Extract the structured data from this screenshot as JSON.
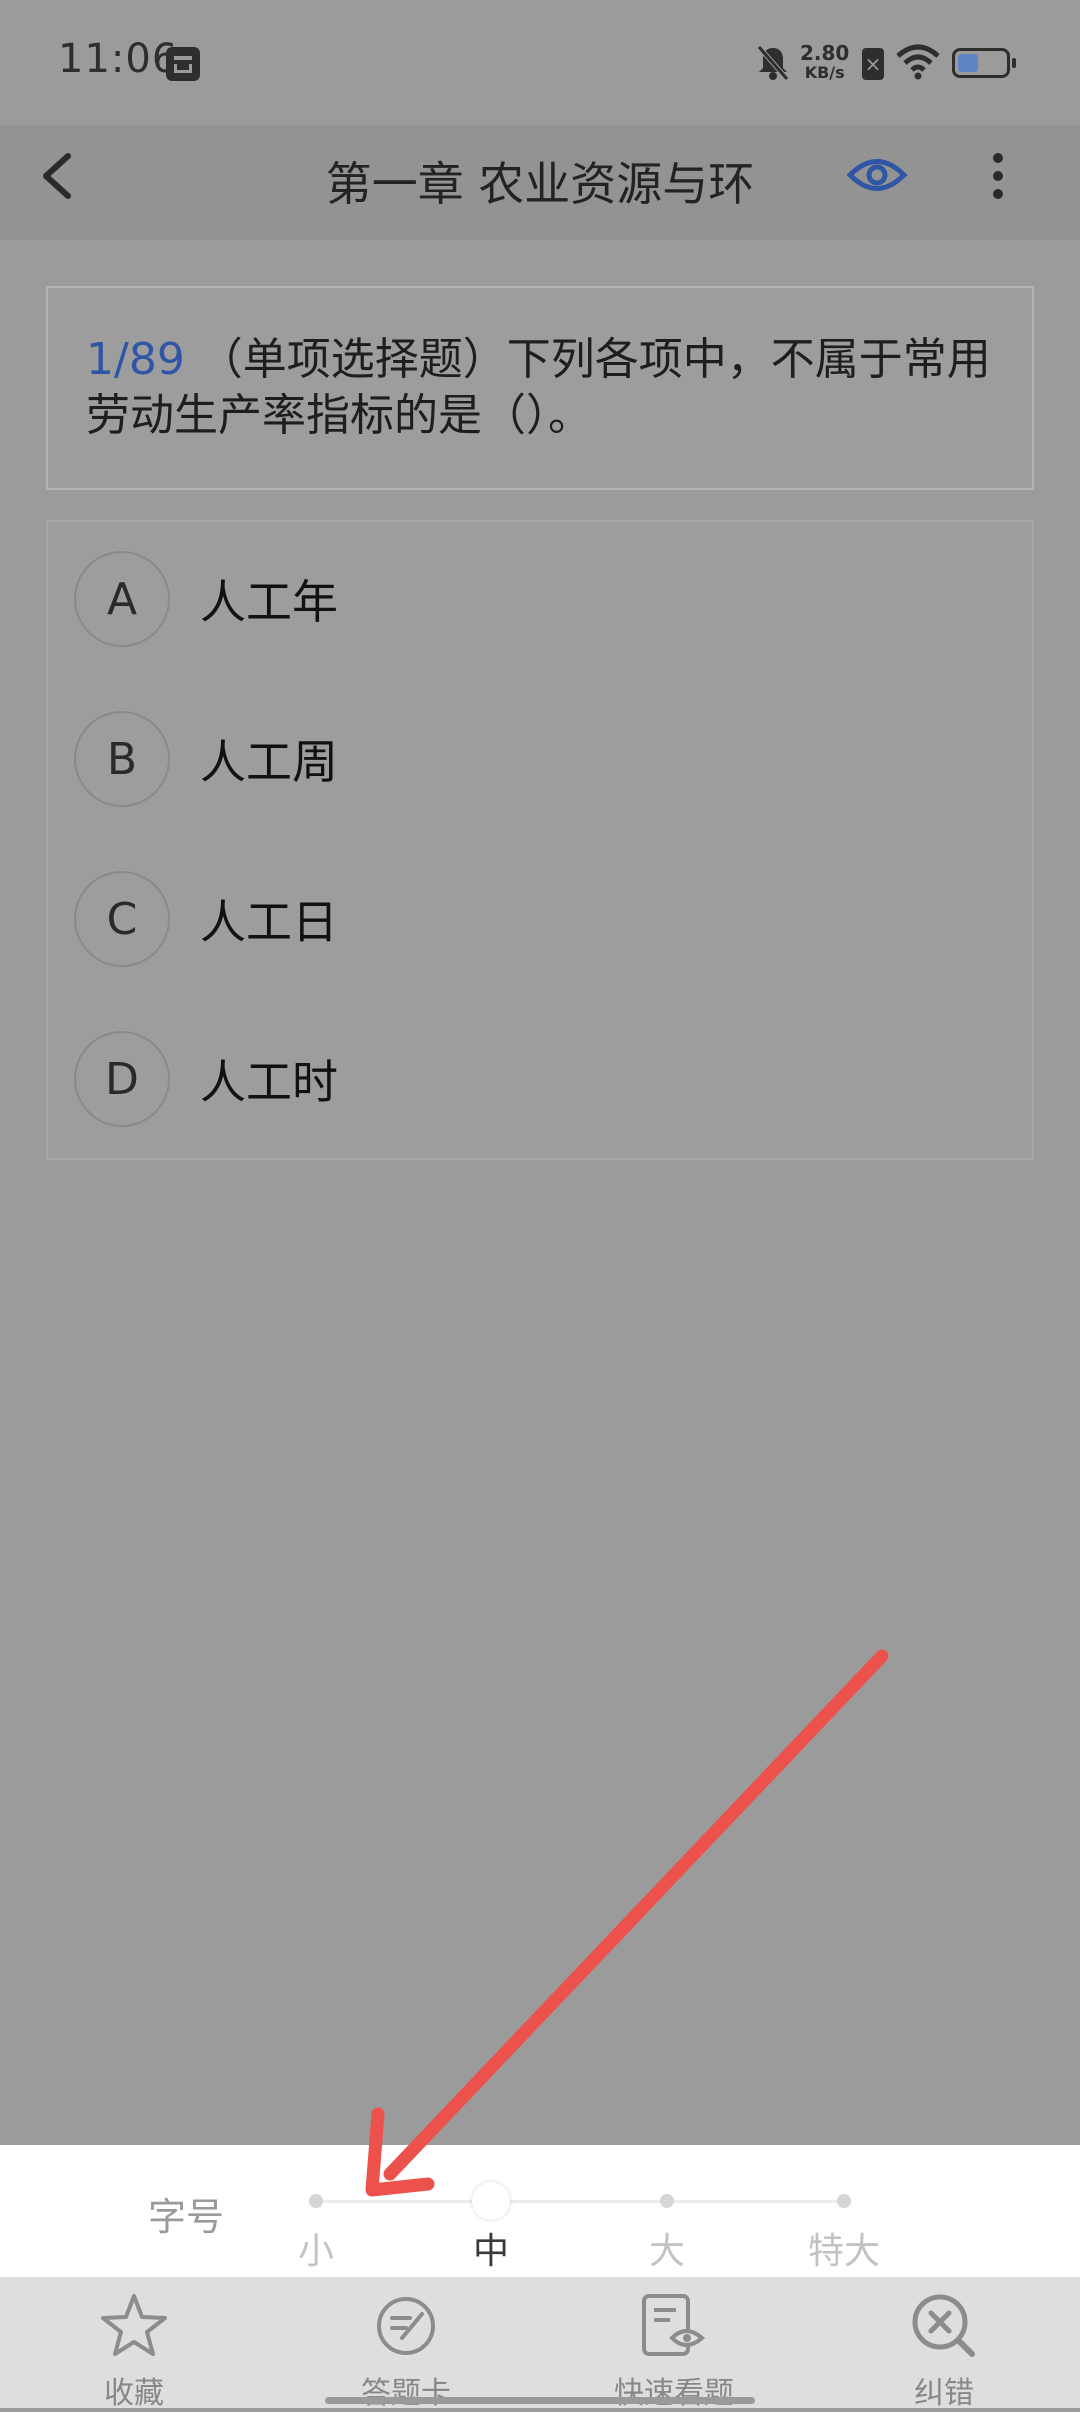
{
  "status_bar": {
    "time": "11:06",
    "net_speed_value": "2.80",
    "net_speed_unit": "KB/s"
  },
  "header": {
    "title": "第一章 农业资源与环",
    "icons": [
      "back-arrow-icon",
      "eye-icon",
      "more-vertical-icon"
    ]
  },
  "question": {
    "number": "1/89",
    "text": " （单项选择题）下列各项中，不属于常用劳动生产率指标的是（）。"
  },
  "options": [
    {
      "letter": "A",
      "text": "人工年"
    },
    {
      "letter": "B",
      "text": "人工周"
    },
    {
      "letter": "C",
      "text": "人工日"
    },
    {
      "letter": "D",
      "text": "人工时"
    }
  ],
  "font_size_panel": {
    "label": "字号",
    "sizes": [
      "小",
      "中",
      "大",
      "特大"
    ],
    "selected_index": 1
  },
  "bottom_nav": {
    "items": [
      {
        "label": "收藏",
        "icon": "star-icon"
      },
      {
        "label": "答题卡",
        "icon": "answer-card-icon"
      },
      {
        "label": "快速看题",
        "icon": "quick-view-icon"
      },
      {
        "label": "纠错",
        "icon": "error-correct-icon"
      }
    ]
  },
  "colors": {
    "accent": "#2f55a6",
    "overlay_background": "#9b9b9b",
    "annotation_arrow": "#ec524b"
  }
}
